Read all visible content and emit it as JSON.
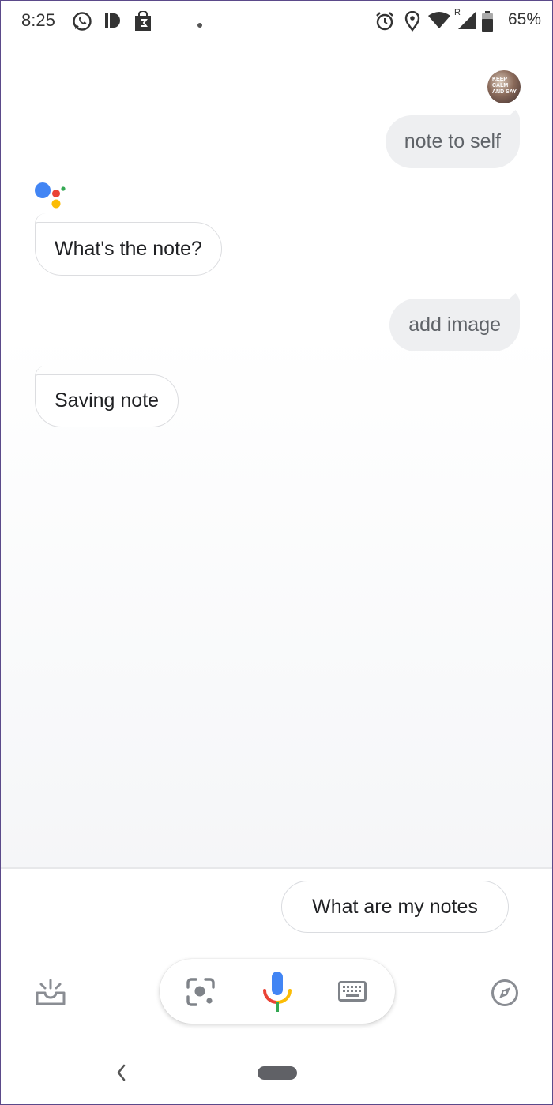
{
  "status_bar": {
    "time": "8:25",
    "battery_percent": "65%",
    "icons": [
      "whatsapp-icon",
      "d-app-icon",
      "shop-bag-icon",
      "notification-dot-icon",
      "alarm-icon",
      "location-icon",
      "wifi-icon",
      "roaming-signal-icon",
      "battery-icon"
    ],
    "roaming_mark": "R"
  },
  "conversation": {
    "messages": [
      {
        "sender": "user",
        "text": "note to self"
      },
      {
        "sender": "assistant",
        "text": "What's the note?"
      },
      {
        "sender": "user",
        "text": "add image"
      },
      {
        "sender": "assistant",
        "text": "Saving note"
      }
    ],
    "assistant_logo_colors": [
      "#4285f4",
      "#ea4335",
      "#fbbc05",
      "#34a853"
    ]
  },
  "suggestions": [
    "What are my notes"
  ],
  "bottom_bar": {
    "left_icon": "updates-tray-icon",
    "lens_icon": "lens-icon",
    "mic_icon": "mic-icon",
    "keyboard_icon": "keyboard-icon",
    "right_icon": "explore-compass-icon"
  },
  "navigation": {
    "back_icon": "back-chevron-icon",
    "home_icon": "home-pill-icon"
  }
}
